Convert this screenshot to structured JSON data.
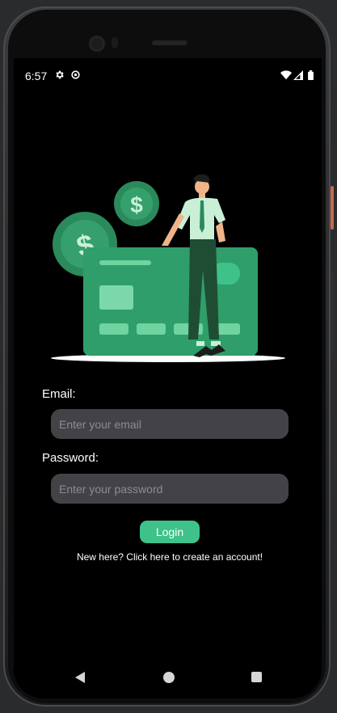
{
  "status_bar": {
    "time": "6:57",
    "left_icons": [
      "settings-icon",
      "settings-gear-icon"
    ],
    "right_icons": [
      "wifi-icon",
      "cell-signal-icon",
      "battery-icon"
    ]
  },
  "illustration": {
    "description_icon": "credit-card-payment-illustration",
    "colors": {
      "card": "#2f9e6a",
      "coin": "#2b8a5c",
      "accent": "#3ec28a",
      "shirt": "#c9f0d7",
      "pants": "#1f4d34"
    }
  },
  "login": {
    "email_label": "Email:",
    "email_placeholder": "Enter your email",
    "email_value": "",
    "password_label": "Password:",
    "password_placeholder": "Enter your password",
    "password_value": "",
    "login_button": "Login",
    "signup_link": "New here? Click here to create an account!"
  },
  "nav_bar": {
    "icons": [
      "back-icon",
      "home-icon",
      "recents-icon"
    ]
  },
  "colors": {
    "background": "#000000",
    "input_bg": "#434347",
    "button_bg": "#3ec28a"
  }
}
